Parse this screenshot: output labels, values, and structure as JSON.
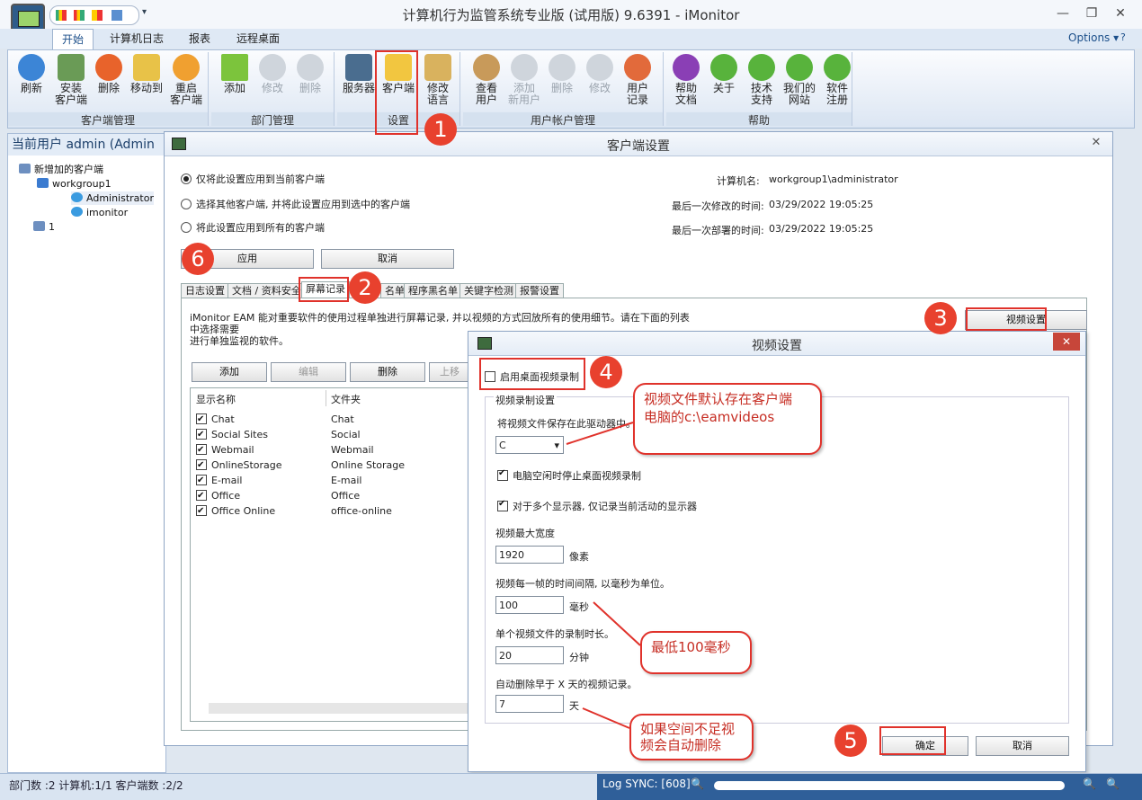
{
  "window": {
    "title": "计算机行为监管系统专业版 (试用版) 9.6391 - iMonitor"
  },
  "tabs": [
    "开始",
    "计算机日志",
    "报表",
    "远程桌面"
  ],
  "options_label": "Options",
  "ribbon": {
    "groups": [
      {
        "label": "客户端管理",
        "buttons": [
          "刷新",
          "安装\n客户端",
          "删除",
          "移动到",
          "重启\n客户端"
        ]
      },
      {
        "label": "部门管理",
        "buttons": [
          "添加",
          "修改",
          "删除"
        ]
      },
      {
        "label": "设置",
        "buttons": [
          "服务器",
          "客户端",
          "修改\n语言"
        ]
      },
      {
        "label": "用户帐户管理",
        "buttons": [
          "查看\n用户",
          "添加\n新用户",
          "删除",
          "修改",
          "用户\n记录"
        ]
      },
      {
        "label": "帮助",
        "buttons": [
          "帮助\n文档",
          "关于",
          "技术\n支持",
          "我们的\n网站",
          "软件\n注册"
        ]
      }
    ]
  },
  "left_panel": {
    "header": "当前用户 admin (Admin",
    "tree": [
      {
        "label": "新增加的客户端",
        "level": 0
      },
      {
        "label": "workgroup1",
        "level": 1
      },
      {
        "label": "Administrator",
        "level": 2
      },
      {
        "label": "imonitor",
        "level": 2
      },
      {
        "label": "1",
        "level": 0
      }
    ]
  },
  "client_dialog": {
    "title": "客户端设置",
    "radios": [
      {
        "label": "仅将此设置应用到当前客户端",
        "selected": true
      },
      {
        "label": "选择其他客户端, 并将此设置应用到选中的客户端",
        "selected": false
      },
      {
        "label": "将此设置应用到所有的客户端",
        "selected": false
      }
    ],
    "info": [
      {
        "label": "计算机名:",
        "value": "workgroup1\\administrator"
      },
      {
        "label": "最后一次修改的时间:",
        "value": "03/29/2022 19:05:25"
      },
      {
        "label": "最后一次部署的时间:",
        "value": "03/29/2022 19:05:25"
      }
    ],
    "apply": "应用",
    "cancel": "取消",
    "subtabs": [
      "日志设置",
      "文档 / 资料安全",
      "屏幕记录",
      "名单",
      "程序黑名单",
      "关键字检测",
      "报警设置"
    ],
    "description": "iMonitor EAM 能对重要软件的使用过程单独进行屏幕记录, 并以视频的方式回放所有的使用细节。请在下面的列表中选择需要\n进行单独监视的软件。",
    "video_settings_btn": "视频设置",
    "list_buttons": [
      "添加",
      "编辑",
      "删除",
      "上移"
    ],
    "list_headers": [
      "显示名称",
      "文件夹"
    ],
    "list_rows": [
      {
        "name": "Chat",
        "folder": "Chat"
      },
      {
        "name": "Social Sites",
        "folder": "Social"
      },
      {
        "name": "Webmail",
        "folder": "Webmail"
      },
      {
        "name": "OnlineStorage",
        "folder": "Online Storage"
      },
      {
        "name": "E-mail",
        "folder": "E-mail"
      },
      {
        "name": "Office",
        "folder": "Office"
      },
      {
        "name": "Office Online",
        "folder": "office-online"
      }
    ]
  },
  "video_dialog": {
    "title": "视频设置",
    "enable": "启用桌面视频录制",
    "section": "视频录制设置",
    "drive_label": "将视频文件保存在此驱动器中。",
    "drive_value": "C",
    "stop_idle": "电脑空闲时停止桌面视频录制",
    "multi_monitor": "对于多个显示器, 仅记录当前活动的显示器",
    "max_width_label": "视频最大宽度",
    "max_width_value": "1920",
    "max_width_unit": "像素",
    "interval_label": "视频每一帧的时间间隔, 以毫秒为单位。",
    "interval_value": "100",
    "interval_unit": "毫秒",
    "duration_label": "单个视频文件的录制时长。",
    "duration_value": "20",
    "duration_unit": "分钟",
    "autodelete_label": "自动删除早于 X 天的视频记录。",
    "autodelete_value": "7",
    "autodelete_unit": "天",
    "ok": "确定",
    "cancel": "取消"
  },
  "annotations": {
    "badges": [
      "1",
      "2",
      "3",
      "4",
      "5",
      "6"
    ],
    "callout_drive": "视频文件默认存在客户端\n电脑的c:\\eamvideos",
    "callout_interval": "最低100毫秒",
    "callout_delete": "如果空间不足视\n频会自动删除"
  },
  "status": {
    "left": "部门数 :2  计算机:1/1  客户端数 :2/2",
    "log_sync": "Log SYNC: [608]"
  },
  "colors": {
    "accent": "#e0322b",
    "ribbon_blue": "#2f5f99"
  }
}
